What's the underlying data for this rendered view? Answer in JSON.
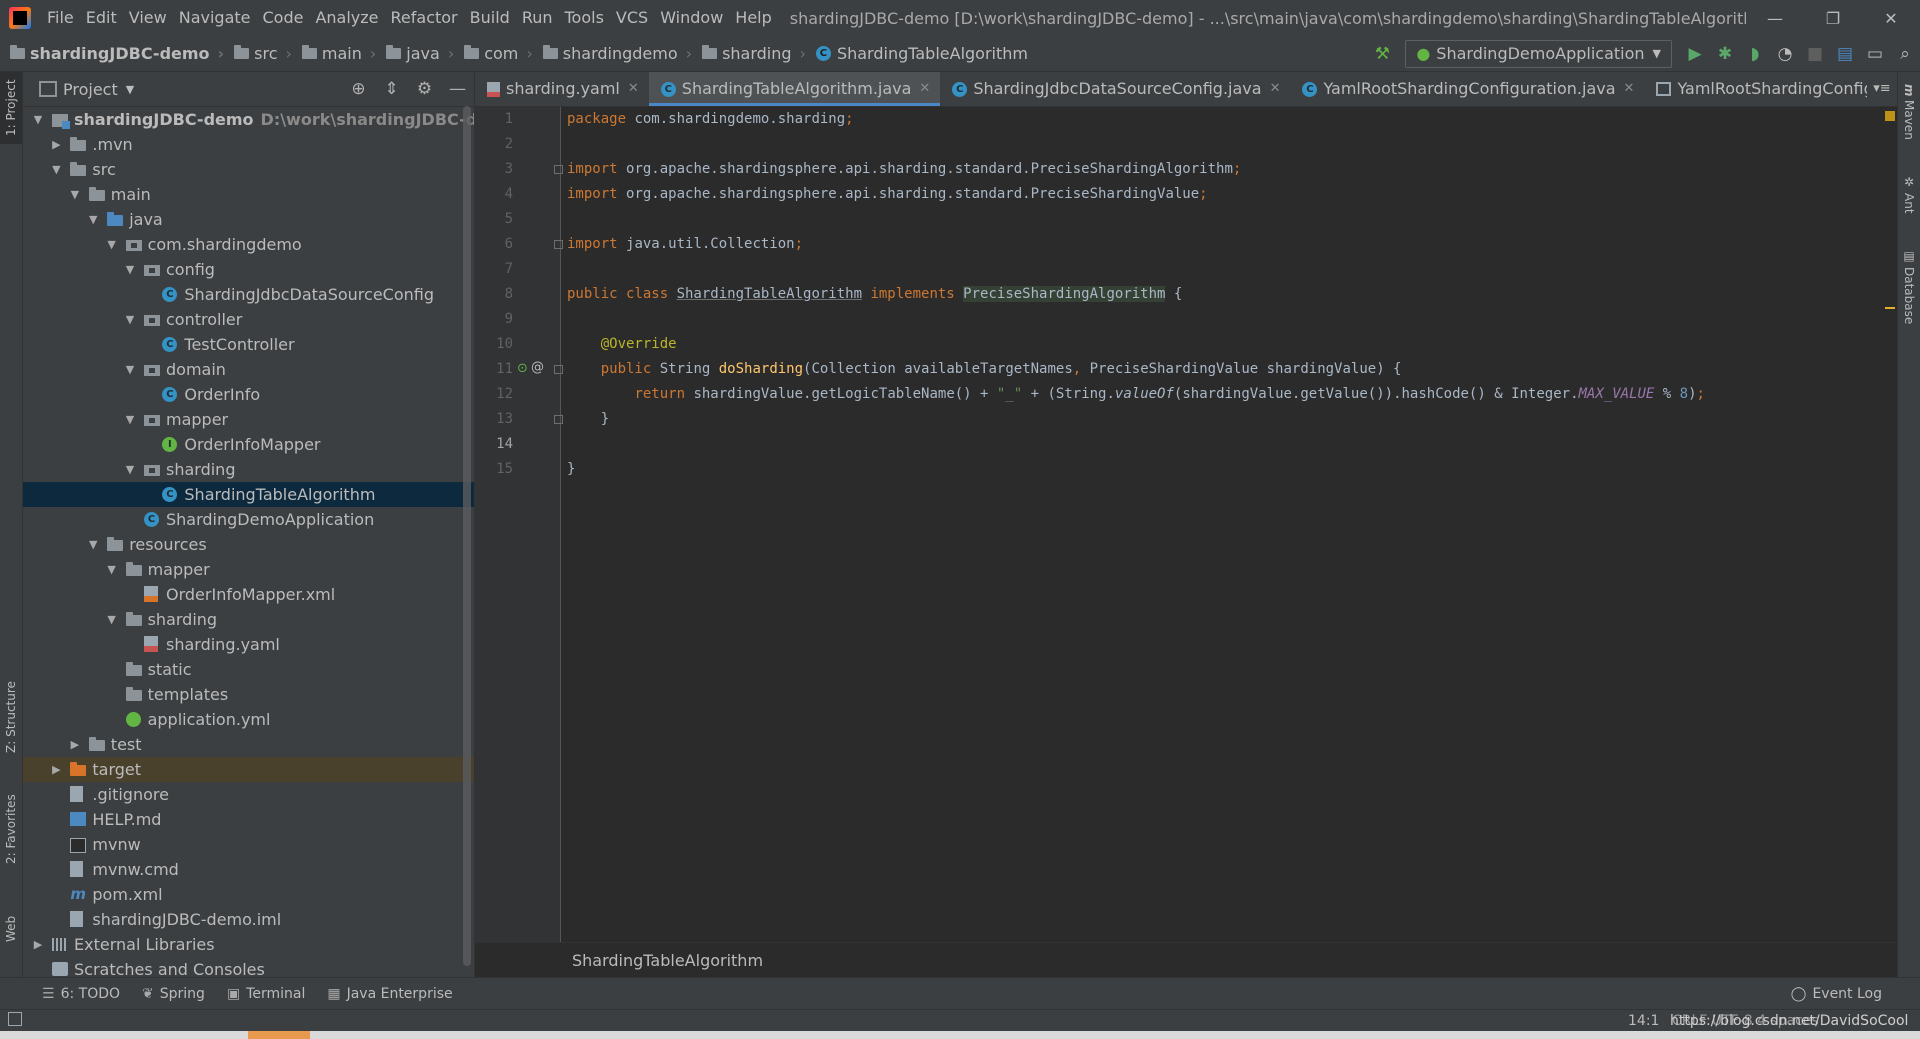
{
  "window": {
    "title": "shardingJDBC-demo [D:\\work\\shardingJDBC-demo] - ...\\src\\main\\java\\com\\shardingdemo\\sharding\\ShardingTableAlgorithm.java"
  },
  "menu": [
    "File",
    "Edit",
    "View",
    "Navigate",
    "Code",
    "Analyze",
    "Refactor",
    "Build",
    "Run",
    "Tools",
    "VCS",
    "Window",
    "Help"
  ],
  "breadcrumbs": [
    "shardingJDBC-demo",
    "src",
    "main",
    "java",
    "com",
    "shardingdemo",
    "sharding",
    "ShardingTableAlgorithm"
  ],
  "run_config": "ShardingDemoApplication",
  "left_tabs": [
    "1: Project",
    "Z: Structure",
    "2: Favorites",
    "Web"
  ],
  "right_tabs": [
    "Maven",
    "Ant",
    "Database"
  ],
  "project_panel": {
    "title": "Project",
    "tree": [
      {
        "label": "shardingJDBC-demo",
        "hint": "D:\\work\\shardingJDBC-demo",
        "level": 0,
        "arrow": "down",
        "icon": "module",
        "bold": true
      },
      {
        "label": ".mvn",
        "level": 1,
        "arrow": "right",
        "icon": "folder"
      },
      {
        "label": "src",
        "level": 1,
        "arrow": "down",
        "icon": "folder"
      },
      {
        "label": "main",
        "level": 2,
        "arrow": "down",
        "icon": "folder"
      },
      {
        "label": "java",
        "level": 3,
        "arrow": "down",
        "icon": "folder src"
      },
      {
        "label": "com.shardingdemo",
        "level": 4,
        "arrow": "down",
        "icon": "package"
      },
      {
        "label": "config",
        "level": 5,
        "arrow": "down",
        "icon": "package"
      },
      {
        "label": "ShardingJdbcDataSourceConfig",
        "level": 6,
        "arrow": "",
        "icon": "class"
      },
      {
        "label": "controller",
        "level": 5,
        "arrow": "down",
        "icon": "package"
      },
      {
        "label": "TestController",
        "level": 6,
        "arrow": "",
        "icon": "class"
      },
      {
        "label": "domain",
        "level": 5,
        "arrow": "down",
        "icon": "package"
      },
      {
        "label": "OrderInfo",
        "level": 6,
        "arrow": "",
        "icon": "class"
      },
      {
        "label": "mapper",
        "level": 5,
        "arrow": "down",
        "icon": "package"
      },
      {
        "label": "OrderInfoMapper",
        "level": 6,
        "arrow": "",
        "icon": "iface"
      },
      {
        "label": "sharding",
        "level": 5,
        "arrow": "down",
        "icon": "package"
      },
      {
        "label": "ShardingTableAlgorithm",
        "level": 6,
        "arrow": "",
        "icon": "class",
        "selected": true
      },
      {
        "label": "ShardingDemoApplication",
        "level": 5,
        "arrow": "",
        "icon": "class"
      },
      {
        "label": "resources",
        "level": 3,
        "arrow": "down",
        "icon": "folder"
      },
      {
        "label": "mapper",
        "level": 4,
        "arrow": "down",
        "icon": "folder"
      },
      {
        "label": "OrderInfoMapper.xml",
        "level": 5,
        "arrow": "",
        "icon": "xml"
      },
      {
        "label": "sharding",
        "level": 4,
        "arrow": "down",
        "icon": "folder"
      },
      {
        "label": "sharding.yaml",
        "level": 5,
        "arrow": "",
        "icon": "yaml"
      },
      {
        "label": "static",
        "level": 4,
        "arrow": "",
        "icon": "folder"
      },
      {
        "label": "templates",
        "level": 4,
        "arrow": "",
        "icon": "folder"
      },
      {
        "label": "application.yml",
        "level": 4,
        "arrow": "",
        "icon": "spring"
      },
      {
        "label": "test",
        "level": 2,
        "arrow": "right",
        "icon": "folder"
      },
      {
        "label": "target",
        "level": 1,
        "arrow": "right",
        "icon": "folder orange",
        "excluded": true
      },
      {
        "label": ".gitignore",
        "level": 1,
        "arrow": "",
        "icon": "file"
      },
      {
        "label": "HELP.md",
        "level": 1,
        "arrow": "",
        "icon": "md"
      },
      {
        "label": "mvnw",
        "level": 1,
        "arrow": "",
        "icon": "exe"
      },
      {
        "label": "mvnw.cmd",
        "level": 1,
        "arrow": "",
        "icon": "file"
      },
      {
        "label": "pom.xml",
        "level": 1,
        "arrow": "",
        "icon": "maven"
      },
      {
        "label": "shardingJDBC-demo.iml",
        "level": 1,
        "arrow": "",
        "icon": "file"
      },
      {
        "label": "External Libraries",
        "level": 0,
        "arrow": "right",
        "icon": "libs"
      },
      {
        "label": "Scratches and Consoles",
        "level": 0,
        "arrow": "",
        "icon": "scratch"
      }
    ]
  },
  "editor_tabs": [
    {
      "label": "sharding.yaml",
      "icon": "y",
      "active": false
    },
    {
      "label": "ShardingTableAlgorithm.java",
      "icon": "c",
      "active": true
    },
    {
      "label": "ShardingJdbcDataSourceConfig.java",
      "icon": "c",
      "active": false
    },
    {
      "label": "YamlRootShardingConfiguration.java",
      "icon": "c",
      "active": false
    },
    {
      "label": "YamlRootShardingConfiguratic",
      "icon": "s",
      "active": false
    }
  ],
  "code_lines": [
    [
      {
        "t": "package ",
        "c": "kw"
      },
      {
        "t": "com.shardingdemo.sharding"
      },
      {
        "t": ";",
        "c": "kw"
      }
    ],
    [],
    [
      {
        "t": "import ",
        "c": "kw"
      },
      {
        "t": "org.apache.shardingsphere.api.sharding.standard.PreciseShardingAlgorithm"
      },
      {
        "t": ";",
        "c": "kw"
      }
    ],
    [
      {
        "t": "import ",
        "c": "kw"
      },
      {
        "t": "org.apache.shardingsphere.api.sharding.standard.PreciseShardingValue"
      },
      {
        "t": ";",
        "c": "kw"
      }
    ],
    [],
    [
      {
        "t": "import ",
        "c": "kw"
      },
      {
        "t": "java.util.Collection"
      },
      {
        "t": ";",
        "c": "kw"
      }
    ],
    [],
    [
      {
        "t": "public class ",
        "c": "kw"
      },
      {
        "t": "ShardingTableAlgorithm",
        "c": "ul"
      },
      {
        "t": " implements ",
        "c": "kw"
      },
      {
        "t": "PreciseShardingAlgorithm",
        "c": "hl"
      },
      {
        "t": " {"
      }
    ],
    [],
    [
      {
        "t": "    "
      },
      {
        "t": "@Override",
        "c": "an"
      }
    ],
    [
      {
        "t": "    "
      },
      {
        "t": "public ",
        "c": "kw"
      },
      {
        "t": "String "
      },
      {
        "t": "doSharding",
        "c": "fn"
      },
      {
        "t": "(Collection availableTargetNames"
      },
      {
        "t": ", ",
        "c": "kw"
      },
      {
        "t": "PreciseShardingValue shardingValue) {"
      }
    ],
    [
      {
        "t": "        "
      },
      {
        "t": "return ",
        "c": "kw"
      },
      {
        "t": "shardingValue.getLogicTableName() + "
      },
      {
        "t": "\"_\"",
        "c": "st"
      },
      {
        "t": " + (String."
      },
      {
        "t": "valueOf",
        "c": "it"
      },
      {
        "t": "(shardingValue.getValue()).hashCode() & Integer."
      },
      {
        "t": "MAX_VALUE",
        "c": "cs"
      },
      {
        "t": " % "
      },
      {
        "t": "8",
        "c": "nu"
      },
      {
        "t": ")"
      },
      {
        "t": ";",
        "c": "kw"
      }
    ],
    [
      {
        "t": "    }"
      }
    ],
    [],
    [
      {
        "t": "}"
      }
    ]
  ],
  "current_line": 14,
  "editor_breadcrumb": "ShardingTableAlgorithm",
  "bottom_tools": [
    {
      "label": "6: TODO",
      "icon": "☰"
    },
    {
      "label": "Spring",
      "icon": "❦"
    },
    {
      "label": "Terminal",
      "icon": "▣"
    },
    {
      "label": "Java Enterprise",
      "icon": "▦"
    }
  ],
  "event_log": "Event Log",
  "status": {
    "position": "14:1",
    "encoding": "CRLF  UTF-8  4 spaces",
    "url": "https://blog.csdn.net/DavidSoCool"
  }
}
